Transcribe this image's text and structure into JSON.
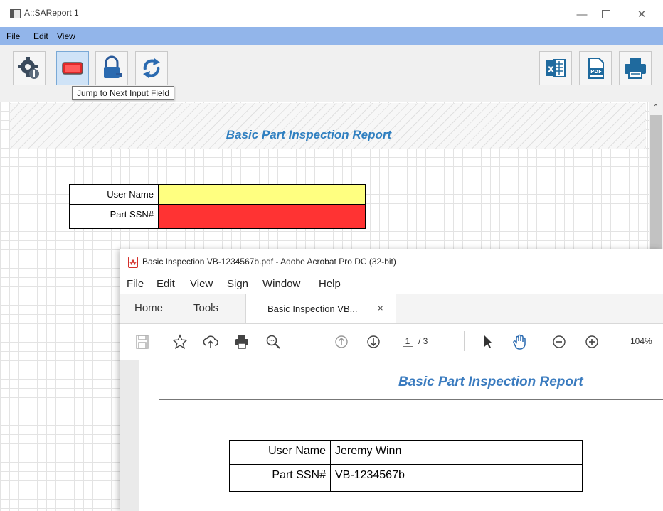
{
  "sa_window": {
    "title": "A::SAReport 1",
    "menu": [
      "File",
      "Edit",
      "View"
    ],
    "toolbar_left": [
      "settings-info-icon",
      "next-input-field-icon",
      "lock-key-icon",
      "refresh-icon"
    ],
    "toolbar_right": [
      "excel-export-icon",
      "pdf-export-icon",
      "print-icon"
    ],
    "tooltip": "Jump to Next Input Field",
    "report_title": "Basic Part Inspection Report",
    "fields": [
      {
        "label": "User Name",
        "value": "",
        "color": "#ffff80"
      },
      {
        "label": "Part SSN#",
        "value": "",
        "color": "#ff3333"
      }
    ]
  },
  "acrobat_window": {
    "title": "Basic Inspection VB-1234567b.pdf - Adobe Acrobat Pro DC (32-bit)",
    "menu": [
      "File",
      "Edit",
      "View",
      "Sign",
      "Window",
      "Help"
    ],
    "tabs": {
      "home": "Home",
      "tools": "Tools",
      "document": "Basic Inspection VB...",
      "close": "×"
    },
    "page_current": "1",
    "page_total": "/ 3",
    "zoom": "104%",
    "report_title": "Basic Part Inspection Report",
    "fields": [
      {
        "label": "User Name",
        "value": "Jeremy Winn"
      },
      {
        "label": "Part SSN#",
        "value": "VB-1234567b"
      }
    ]
  },
  "colors": {
    "menubar": "#92b5ea",
    "accent_title": "#2f7fc0",
    "acrobat_red": "#d4302b"
  }
}
